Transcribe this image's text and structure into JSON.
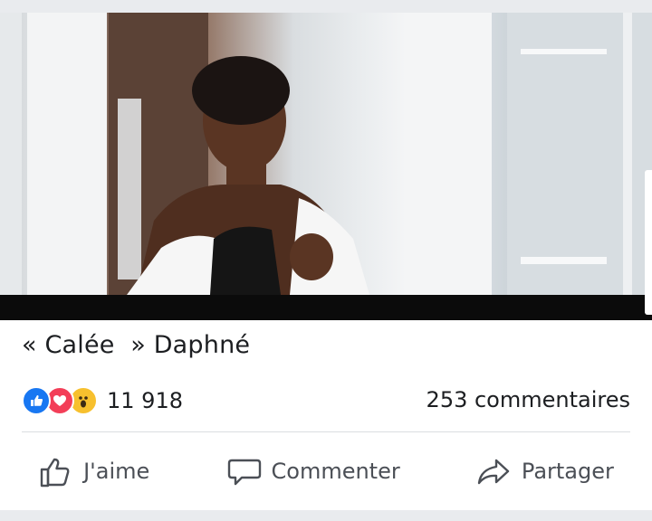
{
  "post": {
    "title": "« Calée  » Daphné",
    "reactions": {
      "icons": [
        "like-icon",
        "love-icon",
        "wow-icon"
      ],
      "count": "11 918"
    },
    "comments_count": "253 commentaires"
  },
  "actions": {
    "like_label": "J'aime",
    "comment_label": "Commenter",
    "share_label": "Partager"
  },
  "colors": {
    "like": "#1877f2",
    "love": "#f33e58",
    "wow": "#f7c02e",
    "action_text": "#4b4f56"
  }
}
